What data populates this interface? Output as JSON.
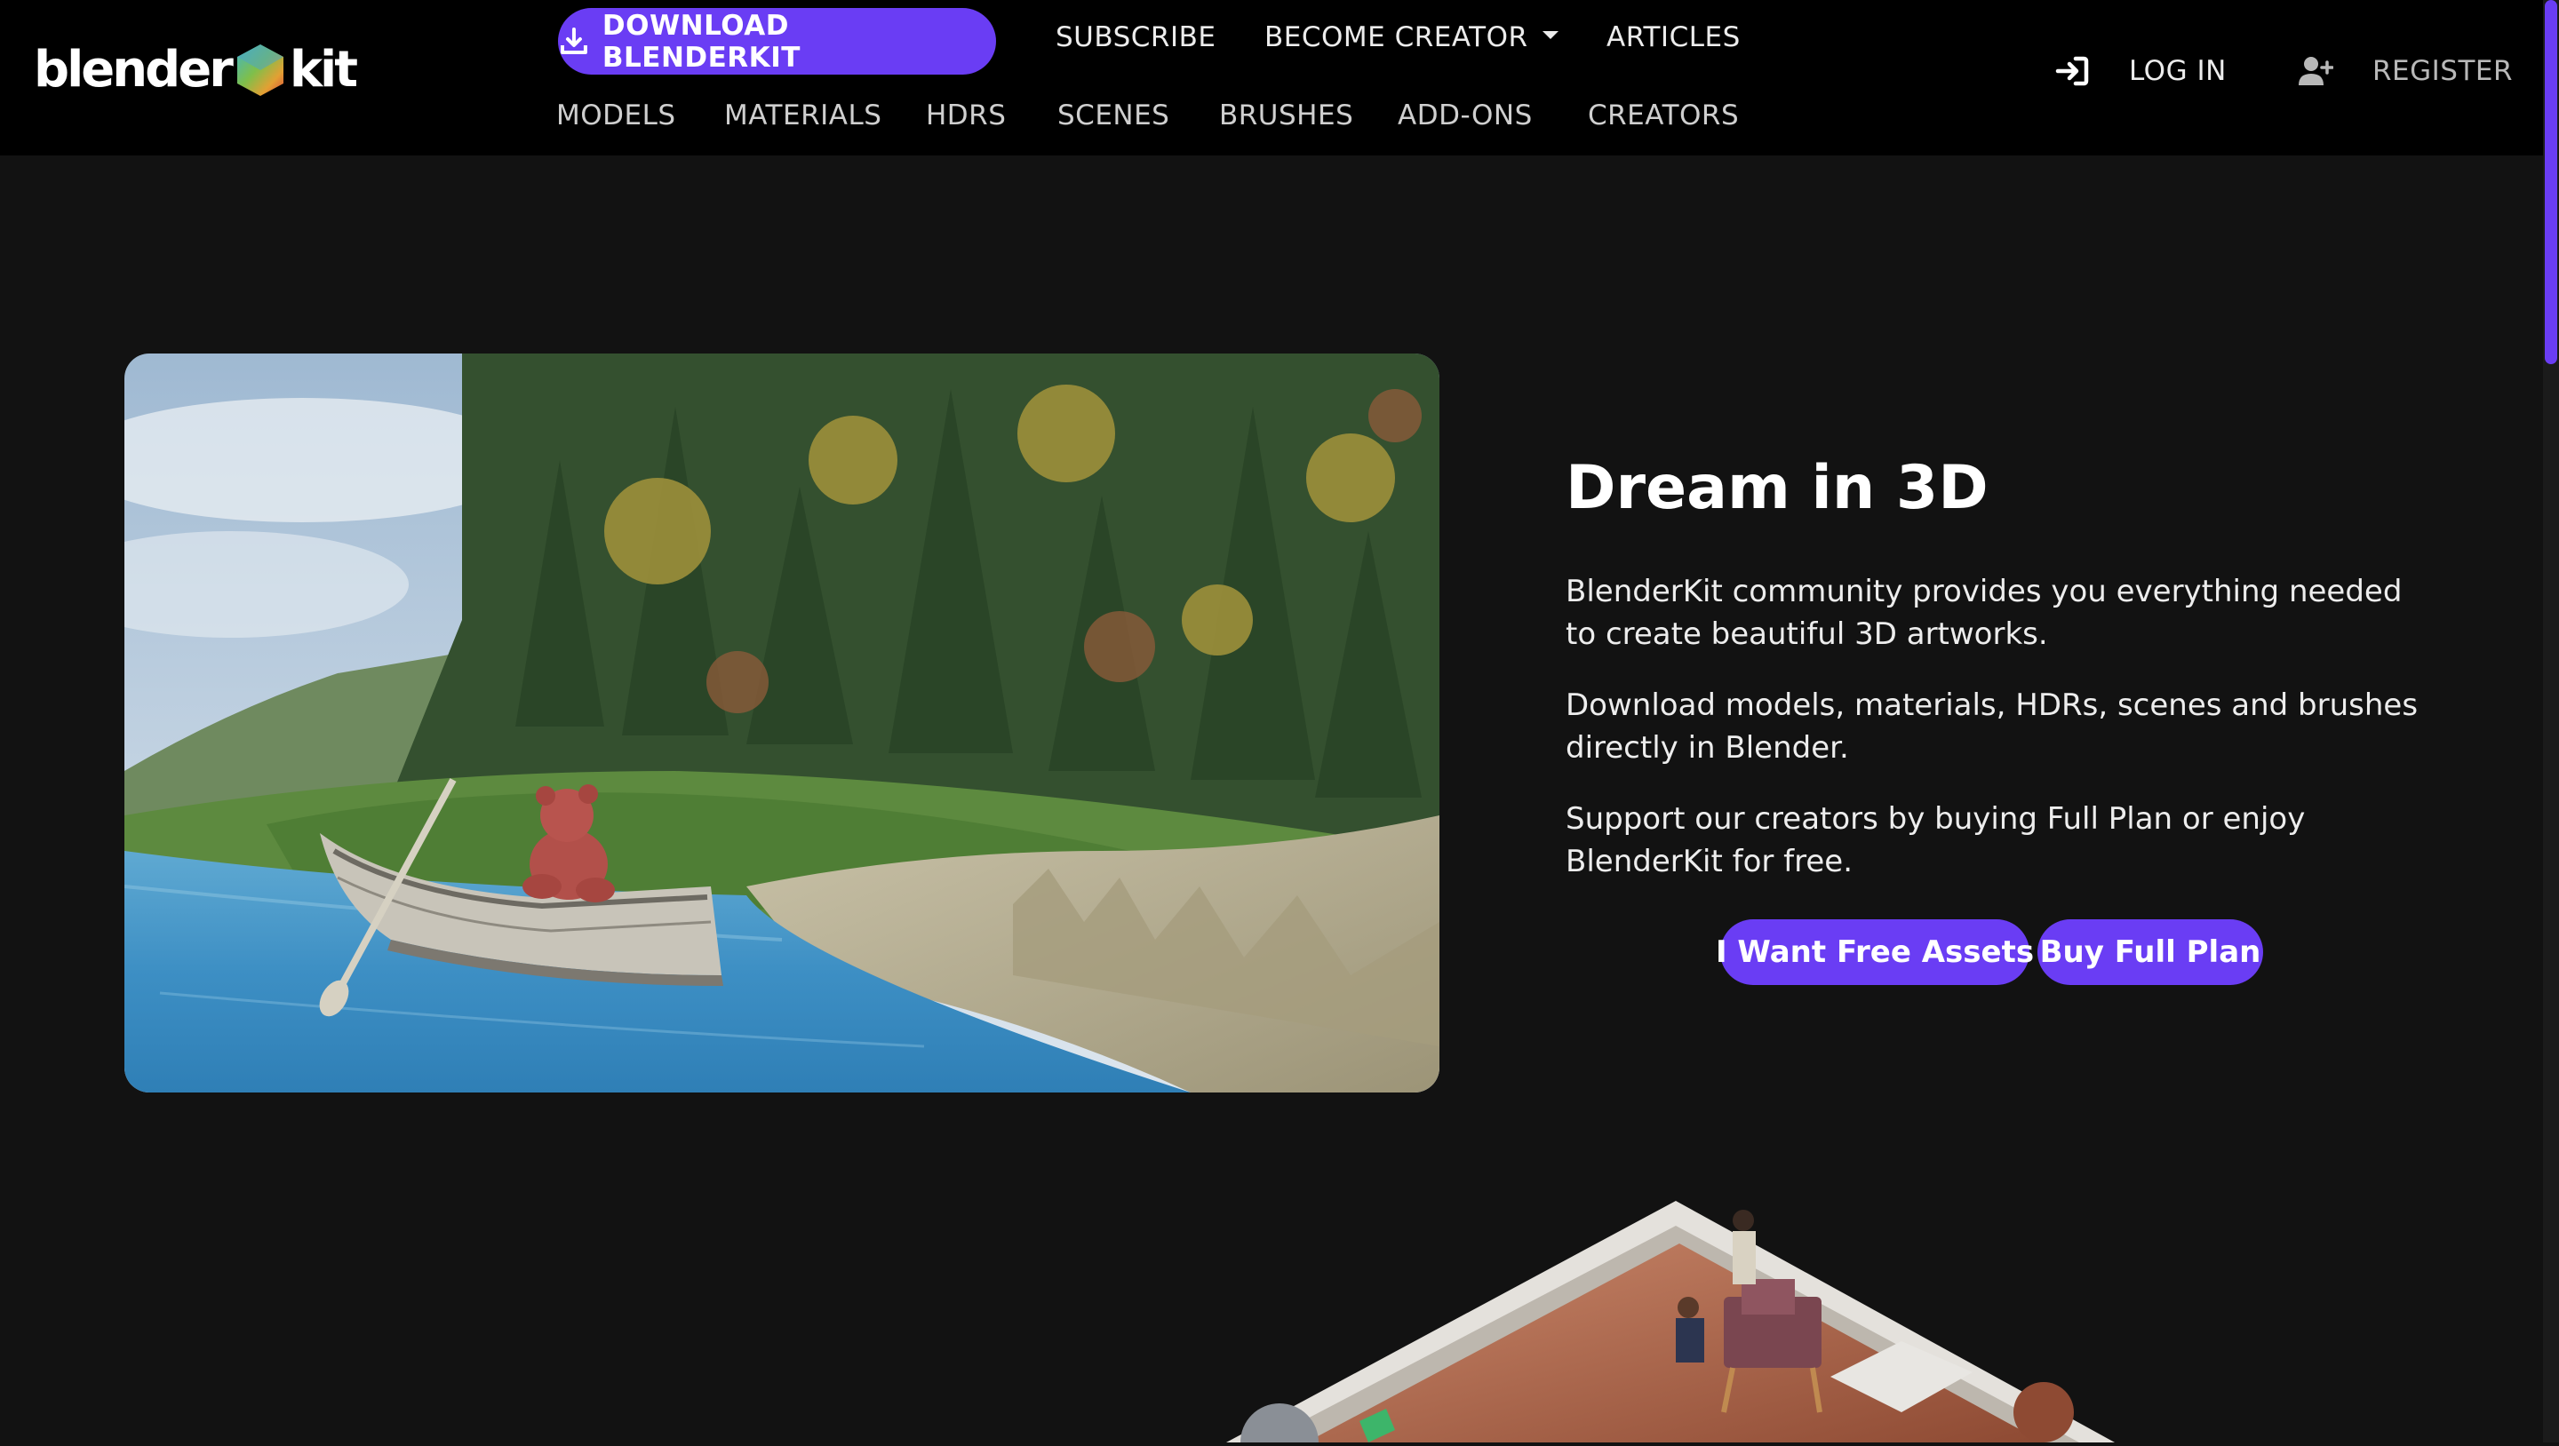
{
  "brand": {
    "logo_left": "blender",
    "logo_right": "kit",
    "accent_color": "#6a3df4"
  },
  "header": {
    "download_label": "DOWNLOAD BLENDERKIT",
    "download_icon": "download-icon",
    "subscribe_label": "SUBSCRIBE",
    "become_creator_label": "BECOME CREATOR",
    "articles_label": "ARTICLES",
    "login_label": "LOG IN",
    "login_icon": "login-icon",
    "register_label": "REGISTER",
    "register_icon": "user-plus-icon"
  },
  "subnav": {
    "items": [
      {
        "label": "MODELS"
      },
      {
        "label": "MATERIALS"
      },
      {
        "label": "HDRS"
      },
      {
        "label": "SCENES"
      },
      {
        "label": "BRUSHES"
      },
      {
        "label": "ADD-ONS"
      },
      {
        "label": "CREATORS"
      }
    ]
  },
  "hero": {
    "title": "Dream in 3D",
    "paragraphs": [
      "BlenderKit community provides you everything needed to create beautiful 3D artworks.",
      "Download models, materials, HDRs, scenes and brushes directly in Blender.",
      "Support our creators by buying Full Plan or enjoy BlenderKit for free."
    ],
    "free_button": "I Want Free Assets",
    "buy_button": "Buy Full Plan"
  }
}
